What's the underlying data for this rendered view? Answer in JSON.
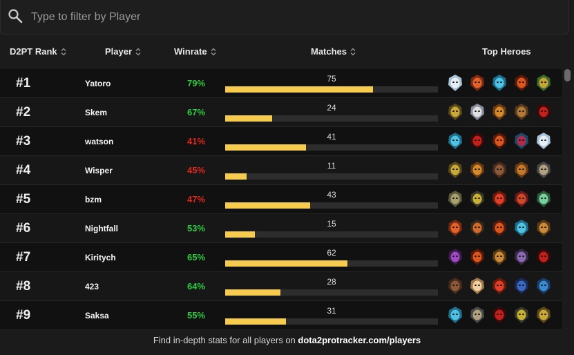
{
  "search": {
    "placeholder": "Type to filter by Player"
  },
  "columns": {
    "rank": "D2PT Rank",
    "player": "Player",
    "winrate": "Winrate",
    "matches": "Matches",
    "heroes": "Top Heroes"
  },
  "colors": {
    "good": "#2ecc40",
    "bad": "#e0281e",
    "bar": "#f7cb4d"
  },
  "max_matches": 108,
  "rows": [
    {
      "rank": "#1",
      "player": "Yatoro",
      "winrate": "79%",
      "status": "good",
      "matches": 75,
      "heroes": [
        "drow-ranger-icon",
        "lina-icon",
        "morphling-icon",
        "ember-spirit-icon",
        "medusa-icon"
      ]
    },
    {
      "rank": "#2",
      "player": "Skem",
      "winrate": "67%",
      "status": "good",
      "matches": 24,
      "heroes": [
        "monkey-king-icon",
        "zeus-icon",
        "juggernaut-icon",
        "bristleback-icon",
        "terrorblade-icon"
      ]
    },
    {
      "rank": "#3",
      "player": "watson",
      "winrate": "41%",
      "status": "bad",
      "matches": 41,
      "heroes": [
        "morphling-icon",
        "terrorblade-icon",
        "ember-spirit-icon",
        "naga-siren-icon",
        "drow-ranger-icon"
      ]
    },
    {
      "rank": "#4",
      "player": "Wisper",
      "winrate": "45%",
      "status": "bad",
      "matches": 11,
      "heroes": [
        "monkey-king-icon",
        "juggernaut-icon",
        "lifestealer-icon",
        "kunkka-icon",
        "troll-warlord-icon"
      ]
    },
    {
      "rank": "#5",
      "player": "bzm",
      "winrate": "47%",
      "status": "bad",
      "matches": 43,
      "heroes": [
        "tiny-icon",
        "sniper-icon",
        "huskar-icon",
        "legion-commander-icon",
        "venomancer-icon"
      ]
    },
    {
      "rank": "#6",
      "player": "Nightfall",
      "winrate": "53%",
      "status": "good",
      "matches": 15,
      "heroes": [
        "lina-icon",
        "ursa-icon",
        "ember-spirit-icon",
        "morphling-icon",
        "brewmaster-icon"
      ]
    },
    {
      "rank": "#7",
      "player": "Kiritych",
      "winrate": "65%",
      "status": "good",
      "matches": 62,
      "heroes": [
        "faceless-void-icon",
        "ember-spirit-icon",
        "brewmaster-icon",
        "tinker-icon",
        "terrorblade-icon"
      ]
    },
    {
      "rank": "#8",
      "player": "423",
      "winrate": "64%",
      "status": "good",
      "matches": 28,
      "heroes": [
        "lifestealer-icon",
        "invoker-icon",
        "huskar-icon",
        "slardar-icon",
        "slark-icon"
      ]
    },
    {
      "rank": "#9",
      "player": "Saksa",
      "winrate": "55%",
      "status": "good",
      "matches": 31,
      "heroes": [
        "morphling-icon",
        "troll-warlord-icon",
        "terrorblade-icon",
        "sniper-icon",
        "monkey-king-icon"
      ]
    }
  ],
  "footer": {
    "text": "Find in-depth stats for all players on",
    "link": "dota2protracker.com/players"
  }
}
